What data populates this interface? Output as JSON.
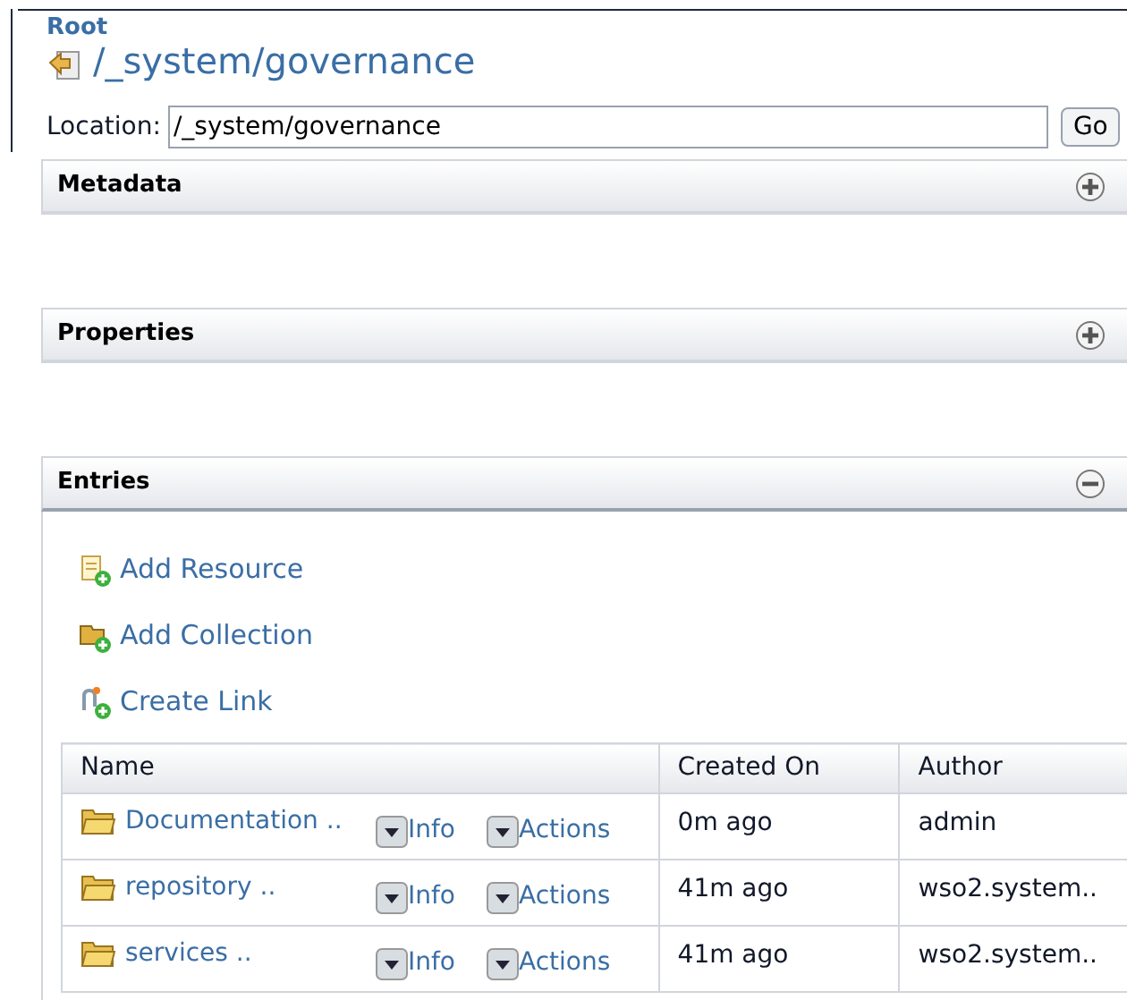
{
  "breadcrumb": "Root",
  "path_title": "/_system/governance",
  "location": {
    "label": "Location:",
    "value": "/_system/governance",
    "button": "Go"
  },
  "panels": [
    {
      "title": "Metadata",
      "expanded": false
    },
    {
      "title": "Properties",
      "expanded": false
    },
    {
      "title": "Entries",
      "expanded": true
    }
  ],
  "entry_actions": [
    {
      "kind": "resource",
      "label": "Add Resource"
    },
    {
      "kind": "collection",
      "label": "Add Collection"
    },
    {
      "kind": "link",
      "label": "Create Link"
    }
  ],
  "table": {
    "columns": [
      "Name",
      "Created On",
      "Author"
    ],
    "rows": [
      {
        "name": "Documentation ..",
        "info": "Info",
        "actions": "Actions",
        "created_on": "0m ago",
        "author": "admin"
      },
      {
        "name": "repository ..",
        "info": "Info",
        "actions": "Actions",
        "created_on": "41m ago",
        "author": "wso2.system.."
      },
      {
        "name": "services ..",
        "info": "Info",
        "actions": "Actions",
        "created_on": "41m ago",
        "author": "wso2.system.."
      }
    ]
  }
}
